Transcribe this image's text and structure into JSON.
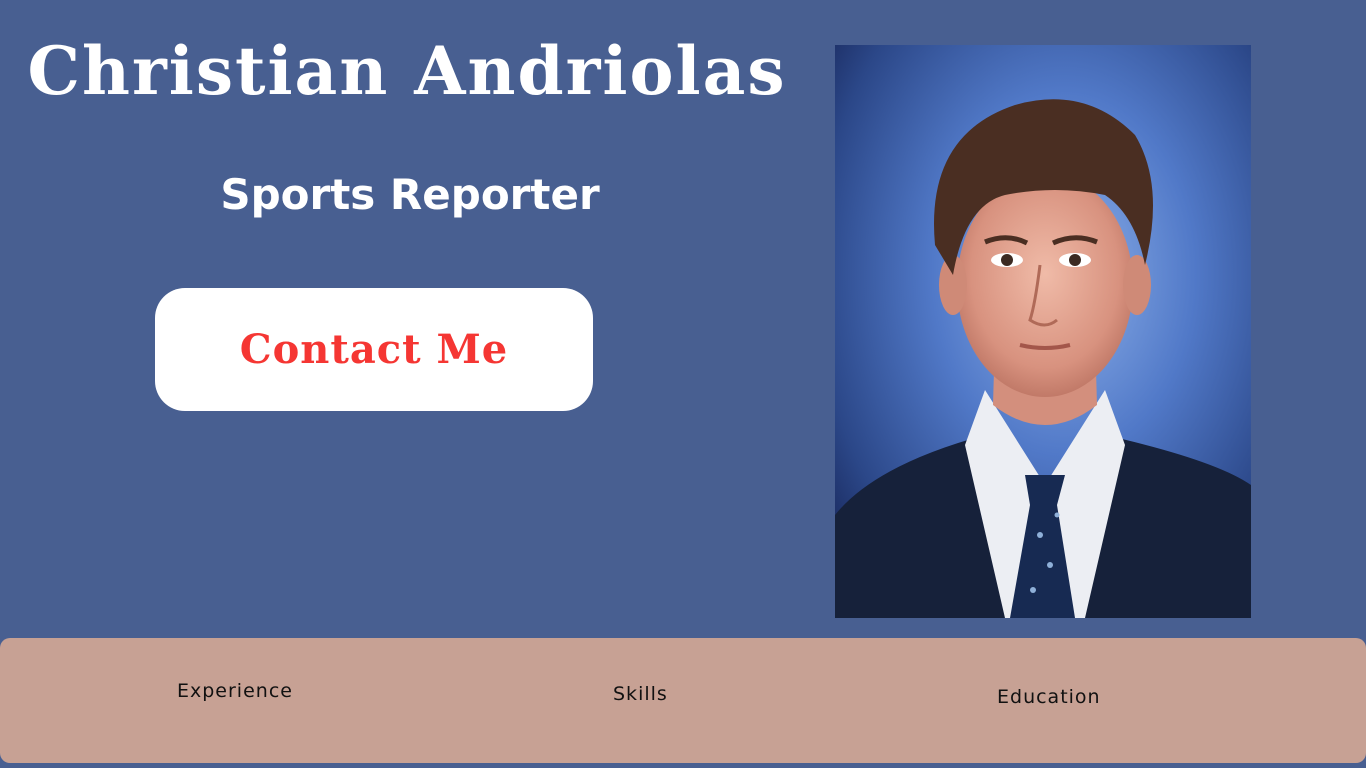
{
  "hero": {
    "name": "Christian Andriolas",
    "role": "Sports Reporter",
    "contact_label": "Contact Me"
  },
  "portrait": {
    "icon": "portrait-photo"
  },
  "nav": {
    "items": [
      {
        "label": "Experience"
      },
      {
        "label": "Skills"
      },
      {
        "label": "Education"
      }
    ]
  },
  "colors": {
    "background": "#485f91",
    "nav_background": "#c7a194",
    "button_text": "#f53633",
    "text_light": "#ffffff"
  }
}
